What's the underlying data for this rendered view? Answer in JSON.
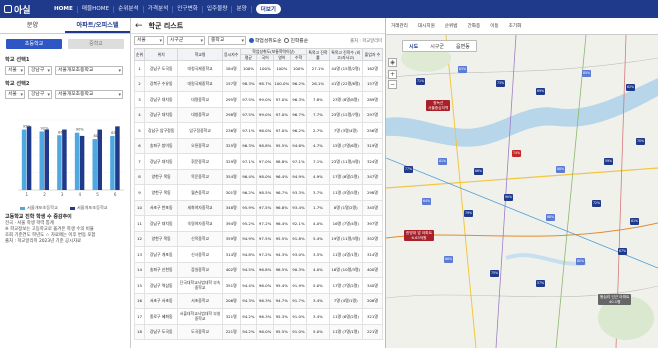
{
  "topbar": {
    "logo": "아실",
    "nav": [
      "HOME",
      "매물HOME",
      "순위분석",
      "가격분석",
      "인구변화",
      "입주물량",
      "분양"
    ],
    "active_nav": "HOME",
    "more": "더보기"
  },
  "left": {
    "tabs": [
      "분양",
      "아파트/오피스텔"
    ],
    "active_tab": "아파트/오피스텔",
    "buttons": [
      "초등학교",
      "중학교"
    ],
    "school_select_title": "학교 선택1",
    "school_select_title2": "학교 선택2",
    "selects1": [
      "서울",
      "강남구",
      "서울개포초등학교"
    ],
    "selects2": [
      "서울",
      "강남구",
      "서울개포초등학교"
    ],
    "chart_data": {
      "type": "bar",
      "categories": [
        "1",
        "2",
        "3",
        "4",
        "5",
        "6"
      ],
      "series": [
        {
          "name": "서울개포초등학교",
          "color": "#4fa9e0",
          "values": [
            95,
            92,
            86,
            90,
            80,
            85
          ]
        },
        {
          "name": "서울개포초등학교",
          "color": "#1f3a8a",
          "values": [
            100,
            95,
            95,
            85,
            95,
            100
          ]
        }
      ],
      "data_labels": [
        "95%",
        "92%",
        "86%",
        "90%",
        "80%",
        "85%"
      ],
      "ylim": [
        0,
        110
      ]
    },
    "legend": [
      "서울개포초등학교",
      "서울개포초등학교"
    ],
    "note_title": "고등학교 진학 학생 수 증감추이",
    "note_lines": [
      "전국 · 서울 학생 학력 통계",
      "※ 학교정보는 고등학교로 옮겨온 학생 수의 비율",
      "조회 기준연도 학년도 ☆ 자료에는 이후 변동 포함",
      "출처 : 학교알리미 2023년 기준 공시자료"
    ]
  },
  "mid": {
    "back": "←",
    "title": "학군 리스트",
    "filters": [
      "서울",
      "시구군",
      "중학교"
    ],
    "radio1": "학업성취도순",
    "radio2": "진학률순",
    "source": "출처 : 학교알리미",
    "headers": [
      "순위",
      "위치",
      "학교명",
      "응시자수",
      "평균",
      "국어",
      "영어",
      "수학",
      "특목고 진학률",
      "특목고 진학수 (외고/자사고)",
      "졸업자 수"
    ],
    "group_header": "학업성취도(보통학력이상)",
    "rows": [
      [
        "1",
        "강남구 도곡동",
        "대청국제중학교",
        "184명",
        "100%",
        "100%",
        "100%",
        "100%",
        "27.1%",
        "44명 (15명/2명)",
        "162명"
      ],
      [
        "2",
        "강북구 수유동",
        "대원국제중학교",
        "157명",
        "98.3%",
        "98.7%",
        "100.0%",
        "96.2%",
        "26.1%",
        "41명 (22명/8명)",
        "157명"
      ],
      [
        "3",
        "강남구 대치동",
        "대명중학교",
        "295명",
        "97.5%",
        "99.0%",
        "97.0%",
        "96.3%",
        "7.8%",
        "23명 (8명/8명)",
        "289명"
      ],
      [
        "4",
        "강남구 대치동",
        "대청중학교",
        "298명",
        "97.5%",
        "99.0%",
        "97.0%",
        "96.7%",
        "7.7%",
        "23명 (12명/7명)",
        "297명"
      ],
      [
        "5",
        "강남구 압구정동",
        "압구정중학교",
        "236명",
        "97.1%",
        "96.0%",
        "97.0%",
        "96.2%",
        "2.7%",
        "7명 (3명/4명)",
        "256명"
      ],
      [
        "6",
        "송파구 방이동",
        "오륜중학교",
        "325명",
        "96.3%",
        "98.8%",
        "95.5%",
        "94.6%",
        "4.7%",
        "15명 (7명/6명)",
        "319명"
      ],
      [
        "7",
        "강남구 대치동",
        "휘문중학교",
        "329명",
        "97.1%",
        "97.0%",
        "98.8%",
        "97.1%",
        "7.1%",
        "23명 (11명/4명)",
        "324명"
      ],
      [
        "8",
        "양천구 목동",
        "목운중학교",
        "354명",
        "96.4%",
        "98.0%",
        "96.4%",
        "94.9%",
        "4.9%",
        "17명 (6명/2명)",
        "347명"
      ],
      [
        "9",
        "양천구 목동",
        "월촌중학교",
        "301명",
        "96.2%",
        "98.5%",
        "96.7%",
        "93.3%",
        "3.7%",
        "11명 (5명/5명)",
        "298명"
      ],
      [
        "10",
        "서초구 반포동",
        "세화여자중학교",
        "348명",
        "95.9%",
        "97.5%",
        "96.8%",
        "93.4%",
        "1.7%",
        "6명 (1명/2명)",
        "345명"
      ],
      [
        "11",
        "강남구 대치동",
        "숙명여자중학교",
        "394명",
        "95.2%",
        "97.2%",
        "96.4%",
        "92.1%",
        "4.0%",
        "16명 (7명/4명)",
        "397명"
      ],
      [
        "12",
        "양천구 목동",
        "신목중학교",
        "359명",
        "94.9%",
        "97.5%",
        "95.5%",
        "91.8%",
        "5.4%",
        "19명 (11명/3명)",
        "352명"
      ],
      [
        "13",
        "강남구 개포동",
        "신사중학교",
        "314명",
        "94.8%",
        "97.2%",
        "94.3%",
        "93.0%",
        "3.5%",
        "11명 (4명/1명)",
        "314명"
      ],
      [
        "14",
        "송파구 신천동",
        "잠실중학교",
        "402명",
        "94.5%",
        "96.8%",
        "96.5%",
        "90.3%",
        "4.0%",
        "16명 (10명/3명)",
        "400명"
      ],
      [
        "15",
        "강남구 역삼동",
        "단국대학교사범대학 부속중학교",
        "351명",
        "94.4%",
        "96.0%",
        "95.4%",
        "91.9%",
        "5.0%",
        "17명 (7명/2명)",
        "340명"
      ],
      [
        "16",
        "서초구 서초동",
        "서초중학교",
        "206명",
        "94.3%",
        "96.3%",
        "94.7%",
        "91.7%",
        "3.4%",
        "7명 (4명/1명)",
        "206명"
      ],
      [
        "17",
        "종로구 혜화동",
        "서울대학교사범대학 부설중학교",
        "321명",
        "94.2%",
        "96.3%",
        "95.3%",
        "91.0%",
        "3.4%",
        "11명 (6명/2명)",
        "321명"
      ],
      [
        "18",
        "강남구 도곡동",
        "도곡중학교",
        "221명",
        "94.2%",
        "96.0%",
        "95.5%",
        "91.0%",
        "5.0%",
        "11명 (7명/1명)",
        "221명"
      ]
    ]
  },
  "map": {
    "tools": [
      "거래트렌드",
      "대시지정",
      "실거래",
      "위성",
      "반석도",
      "지적도"
    ],
    "tools_visible": [
      "거래관리",
      "대시지원",
      "순위법",
      "간화종",
      "이동",
      "초기화"
    ],
    "buttons": [
      "시도",
      "시구군",
      "읍면동"
    ],
    "callouts": [
      "정녹선",
      "서울중심지역",
      "한양대 앞 아파트",
      "6.63억원",
      "왕십리 인근 아파트",
      "40.1평"
    ],
    "pins": [
      "71%",
      "83%",
      "73%",
      "69%",
      "85%",
      "62%",
      "77%",
      "81%",
      "66%",
      "74%",
      "88%",
      "59%",
      "70%",
      "64%",
      "79%",
      "90%",
      "68%",
      "72%",
      "61%",
      "86%",
      "75%",
      "57%",
      "80%",
      "67%"
    ],
    "accent": "#1f3a8a"
  }
}
